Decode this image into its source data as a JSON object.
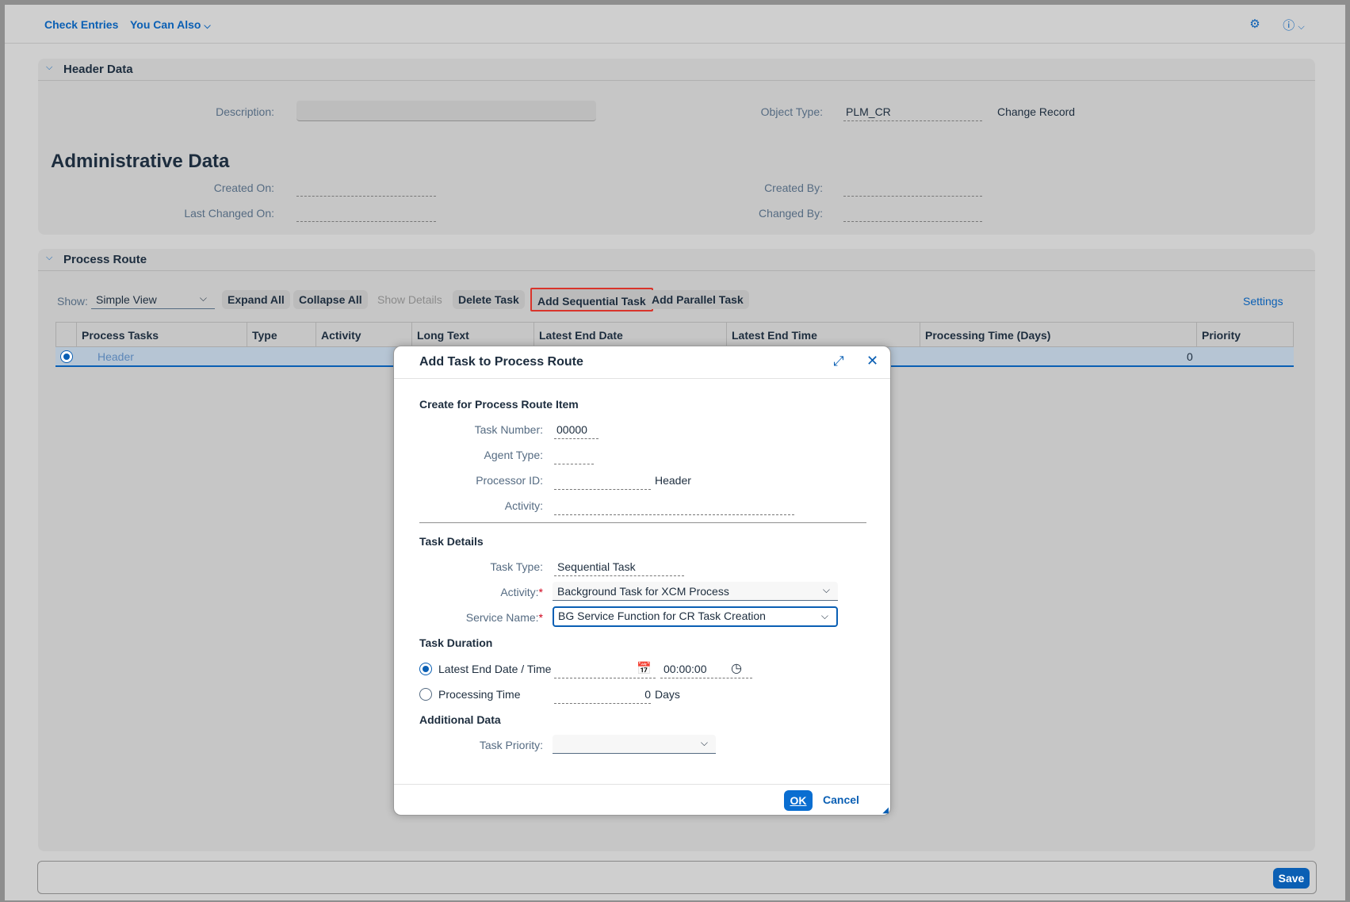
{
  "topbar": {
    "check_entries": "Check Entries",
    "you_can_also": "You Can Also"
  },
  "header_data": {
    "title": "Header Data",
    "description_label": "Description:",
    "description_value": "",
    "object_type_label": "Object Type:",
    "object_type_value": "PLM_CR",
    "object_type_text": "Change Record"
  },
  "admin": {
    "title": "Administrative Data",
    "created_on_label": "Created On:",
    "last_changed_on_label": "Last Changed On:",
    "created_by_label": "Created By:",
    "changed_by_label": "Changed By:"
  },
  "process_route": {
    "title": "Process Route",
    "show_label": "Show:",
    "show_value": "Simple View",
    "buttons": {
      "expand_all": "Expand All",
      "collapse_all": "Collapse All",
      "show_details": "Show Details",
      "delete_task": "Delete Task",
      "add_sequential_task": "Add Sequential Task",
      "add_parallel_task": "Add Parallel Task"
    },
    "settings": "Settings",
    "columns": {
      "process_tasks": "Process Tasks",
      "type": "Type",
      "activity": "Activity",
      "long_text": "Long Text",
      "latest_end_date": "Latest End Date",
      "latest_end_time": "Latest End Time",
      "processing_time": "Processing Time (Days)",
      "priority": "Priority"
    },
    "row": {
      "process_task": "Header",
      "processing_time": "0"
    }
  },
  "dialog": {
    "title": "Add Task to Process Route",
    "section_create": "Create for Process Route Item",
    "task_number_label": "Task Number:",
    "task_number_value": "00000",
    "agent_type_label": "Agent Type:",
    "processor_id_label": "Processor ID:",
    "processor_id_text": "Header",
    "activity_label": "Activity:",
    "section_details": "Task Details",
    "task_type_label": "Task Type:",
    "task_type_value": "Sequential Task",
    "activity2_label": "Activity:",
    "activity2_value": "Background Task for XCM Process",
    "service_name_label": "Service Name:",
    "service_name_value": "BG Service Function for CR Task Creation",
    "section_duration": "Task Duration",
    "latest_end_label": "Latest End Date / Time",
    "latest_end_time_value": "00:00:00",
    "processing_time_label": "Processing Time",
    "processing_time_value": "0",
    "days_label": "Days",
    "section_additional": "Additional Data",
    "task_priority_label": "Task Priority:",
    "required_mark": "*",
    "ok": "OK",
    "cancel": "Cancel"
  },
  "footer": {
    "save": "Save"
  },
  "colors": {
    "accent": "#0a5fb4",
    "highlight_border": "#d9342b"
  }
}
